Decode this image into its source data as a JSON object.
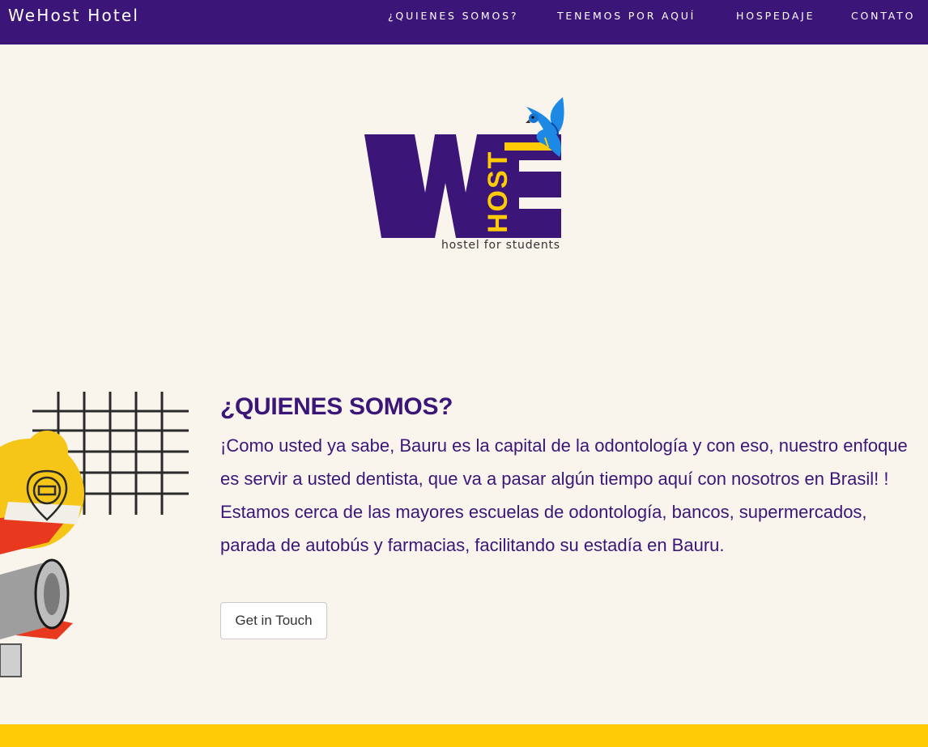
{
  "header": {
    "brand": "WeHost Hotel",
    "nav": [
      {
        "label": "¿QUIENES SOMOS?"
      },
      {
        "label": "TENEMOS POR AQUÍ"
      },
      {
        "label": "HOSPEDAJE"
      },
      {
        "label": "CONTATO"
      }
    ]
  },
  "logo": {
    "we": "WE",
    "host": "HOST",
    "tagline": "hostel for students",
    "icon": "parrot-icon"
  },
  "about": {
    "title": "¿QUIENES SOMOS?",
    "body": "¡Como usted ya sabe, Bauru es la capital de la odontología y con eso, nuestro enfoque es servir a usted dentista, que va a pasar algún tiempo aquí con nosotros en Brasil! ! Estamos cerca de las mayores escuelas de odontología, bancos, supermercados, parada de autobús y farmacias, facilitando su estadía en Bauru.",
    "button_label": "Get in Touch"
  },
  "colors": {
    "brand_purple": "#3b1578",
    "accent_yellow": "#ffcb05",
    "background": "#f9f5ec"
  }
}
